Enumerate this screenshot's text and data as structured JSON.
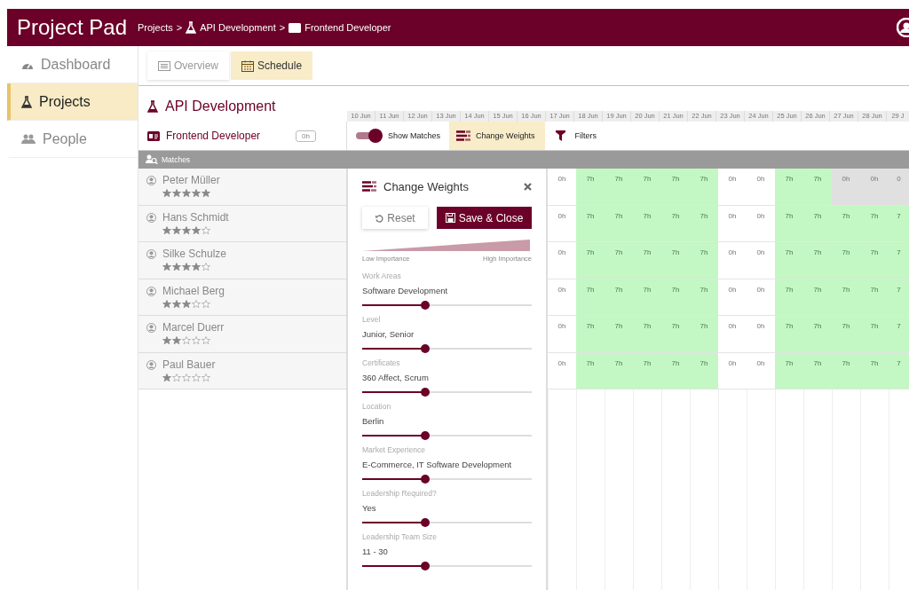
{
  "app_title": "Project Pad",
  "breadcrumb": [
    {
      "kind": "link",
      "text": "Projects"
    },
    {
      "kind": "separator",
      "text": ">"
    },
    {
      "kind": "project",
      "text": "API Development"
    },
    {
      "kind": "separator",
      "text": ">"
    },
    {
      "kind": "role",
      "text": "Frontend Developer"
    }
  ],
  "sidebar": {
    "items": [
      {
        "label": "Dashboard",
        "selected": false
      },
      {
        "label": "Projects",
        "selected": true
      },
      {
        "label": "People",
        "selected": false
      }
    ]
  },
  "tabs": [
    {
      "label": "Overview",
      "selected": false
    },
    {
      "label": "Schedule",
      "selected": true
    }
  ],
  "project": {
    "title": "API Development"
  },
  "dates": [
    "10 Jun",
    "11 Jun",
    "12 Jun",
    "13 Jun",
    "14 Jun",
    "15 Jun",
    "16 Jun",
    "17 Jun",
    "18 Jun",
    "19 Jun",
    "20 Jun",
    "21 Jun",
    "22 Jun",
    "23 Jun",
    "24 Jun",
    "25 Jun",
    "26 Jun",
    "27 Jun",
    "28 Jun",
    "29 J"
  ],
  "role": {
    "title": "Frontend Developer",
    "hours": "0h"
  },
  "toolbar": {
    "show_matches": {
      "label": "Show Matches",
      "on": true
    },
    "change_weights": {
      "label": "Change Weights",
      "selected": true
    },
    "filters": {
      "label": "Filters"
    }
  },
  "matches_label": "Matches",
  "people": [
    {
      "name": "Peter Müller",
      "stars": 5,
      "days": [
        {
          "text": "0h",
          "available": false,
          "dimmed": false
        },
        {
          "text": "7h",
          "available": true,
          "dimmed": false
        },
        {
          "text": "7h",
          "available": true,
          "dimmed": false
        },
        {
          "text": "7h",
          "available": true,
          "dimmed": false
        },
        {
          "text": "7h",
          "available": true,
          "dimmed": false
        },
        {
          "text": "7h",
          "available": true,
          "dimmed": false
        },
        {
          "text": "0h",
          "available": false,
          "dimmed": false
        },
        {
          "text": "0h",
          "available": false,
          "dimmed": false
        },
        {
          "text": "7h",
          "available": true,
          "dimmed": false
        },
        {
          "text": "7h",
          "available": true,
          "dimmed": false
        },
        {
          "text": "0h",
          "available": false,
          "dimmed": true
        },
        {
          "text": "0h",
          "available": false,
          "dimmed": true
        },
        {
          "text": "0",
          "available": false,
          "dimmed": true
        }
      ]
    },
    {
      "name": "Hans Schmidt",
      "stars": 4,
      "days": [
        {
          "text": "0h",
          "available": false,
          "dimmed": false
        },
        {
          "text": "7h",
          "available": true,
          "dimmed": false
        },
        {
          "text": "7h",
          "available": true,
          "dimmed": false
        },
        {
          "text": "7h",
          "available": true,
          "dimmed": false
        },
        {
          "text": "7h",
          "available": true,
          "dimmed": false
        },
        {
          "text": "7h",
          "available": true,
          "dimmed": false
        },
        {
          "text": "0h",
          "available": false,
          "dimmed": false
        },
        {
          "text": "0h",
          "available": false,
          "dimmed": false
        },
        {
          "text": "7h",
          "available": true,
          "dimmed": false
        },
        {
          "text": "7h",
          "available": true,
          "dimmed": false
        },
        {
          "text": "7h",
          "available": true,
          "dimmed": false
        },
        {
          "text": "7h",
          "available": true,
          "dimmed": false
        },
        {
          "text": "7",
          "available": true,
          "dimmed": false
        }
      ]
    },
    {
      "name": "Silke Schulze",
      "stars": 4,
      "days": [
        {
          "text": "0h",
          "available": false,
          "dimmed": false
        },
        {
          "text": "7h",
          "available": true,
          "dimmed": false
        },
        {
          "text": "7h",
          "available": true,
          "dimmed": false
        },
        {
          "text": "7h",
          "available": true,
          "dimmed": false
        },
        {
          "text": "7h",
          "available": true,
          "dimmed": false
        },
        {
          "text": "7h",
          "available": true,
          "dimmed": false
        },
        {
          "text": "0h",
          "available": false,
          "dimmed": false
        },
        {
          "text": "0h",
          "available": false,
          "dimmed": false
        },
        {
          "text": "7h",
          "available": true,
          "dimmed": false
        },
        {
          "text": "7h",
          "available": true,
          "dimmed": false
        },
        {
          "text": "7h",
          "available": true,
          "dimmed": false
        },
        {
          "text": "7h",
          "available": true,
          "dimmed": false
        },
        {
          "text": "7",
          "available": true,
          "dimmed": false
        }
      ]
    },
    {
      "name": "Michael Berg",
      "stars": 3,
      "days": [
        {
          "text": "0h",
          "available": false,
          "dimmed": false
        },
        {
          "text": "7h",
          "available": true,
          "dimmed": false
        },
        {
          "text": "7h",
          "available": true,
          "dimmed": false
        },
        {
          "text": "7h",
          "available": true,
          "dimmed": false
        },
        {
          "text": "7h",
          "available": true,
          "dimmed": false
        },
        {
          "text": "7h",
          "available": true,
          "dimmed": false
        },
        {
          "text": "0h",
          "available": false,
          "dimmed": false
        },
        {
          "text": "0h",
          "available": false,
          "dimmed": false
        },
        {
          "text": "7h",
          "available": true,
          "dimmed": false
        },
        {
          "text": "7h",
          "available": true,
          "dimmed": false
        },
        {
          "text": "7h",
          "available": true,
          "dimmed": false
        },
        {
          "text": "7h",
          "available": true,
          "dimmed": false
        },
        {
          "text": "7",
          "available": true,
          "dimmed": false
        }
      ]
    },
    {
      "name": "Marcel Duerr",
      "stars": 2,
      "days": [
        {
          "text": "0h",
          "available": false,
          "dimmed": false
        },
        {
          "text": "7h",
          "available": true,
          "dimmed": false
        },
        {
          "text": "7h",
          "available": true,
          "dimmed": false
        },
        {
          "text": "7h",
          "available": true,
          "dimmed": false
        },
        {
          "text": "7h",
          "available": true,
          "dimmed": false
        },
        {
          "text": "7h",
          "available": true,
          "dimmed": false
        },
        {
          "text": "0h",
          "available": false,
          "dimmed": false
        },
        {
          "text": "0h",
          "available": false,
          "dimmed": false
        },
        {
          "text": "7h",
          "available": true,
          "dimmed": false
        },
        {
          "text": "7h",
          "available": true,
          "dimmed": false
        },
        {
          "text": "7h",
          "available": true,
          "dimmed": false
        },
        {
          "text": "7h",
          "available": true,
          "dimmed": false
        },
        {
          "text": "7",
          "available": true,
          "dimmed": false
        }
      ]
    },
    {
      "name": "Paul Bauer",
      "stars": 1,
      "days": [
        {
          "text": "0h",
          "available": false,
          "dimmed": false
        },
        {
          "text": "7h",
          "available": true,
          "dimmed": false
        },
        {
          "text": "7h",
          "available": true,
          "dimmed": false
        },
        {
          "text": "7h",
          "available": true,
          "dimmed": false
        },
        {
          "text": "7h",
          "available": true,
          "dimmed": false
        },
        {
          "text": "7h",
          "available": true,
          "dimmed": false
        },
        {
          "text": "0h",
          "available": false,
          "dimmed": false
        },
        {
          "text": "0h",
          "available": false,
          "dimmed": false
        },
        {
          "text": "7h",
          "available": true,
          "dimmed": false
        },
        {
          "text": "7h",
          "available": true,
          "dimmed": false
        },
        {
          "text": "7h",
          "available": true,
          "dimmed": false
        },
        {
          "text": "7h",
          "available": true,
          "dimmed": false
        },
        {
          "text": "7",
          "available": true,
          "dimmed": false
        }
      ]
    }
  ],
  "weights_panel": {
    "title": "Change Weights",
    "reset_label": "Reset",
    "save_label": "Save & Close",
    "scale": {
      "low": "Low Importance",
      "high": "High Importance"
    },
    "criteria": [
      {
        "label": "Work Areas",
        "value": "Software Development",
        "level": 0.37
      },
      {
        "label": "Level",
        "value": "Junior, Senior",
        "level": 0.37
      },
      {
        "label": "Certificates",
        "value": "360 Affect, Scrum",
        "level": 0.37
      },
      {
        "label": "Location",
        "value": "Berlin",
        "level": 0.37
      },
      {
        "label": "Market Experience",
        "value": "E-Commerce, IT Software Development",
        "level": 0.37
      },
      {
        "label": "Leadership Required?",
        "value": "Yes",
        "level": 0.37
      },
      {
        "label": "Leadership Team Size",
        "value": "11 - 30",
        "level": 0.37
      }
    ]
  }
}
